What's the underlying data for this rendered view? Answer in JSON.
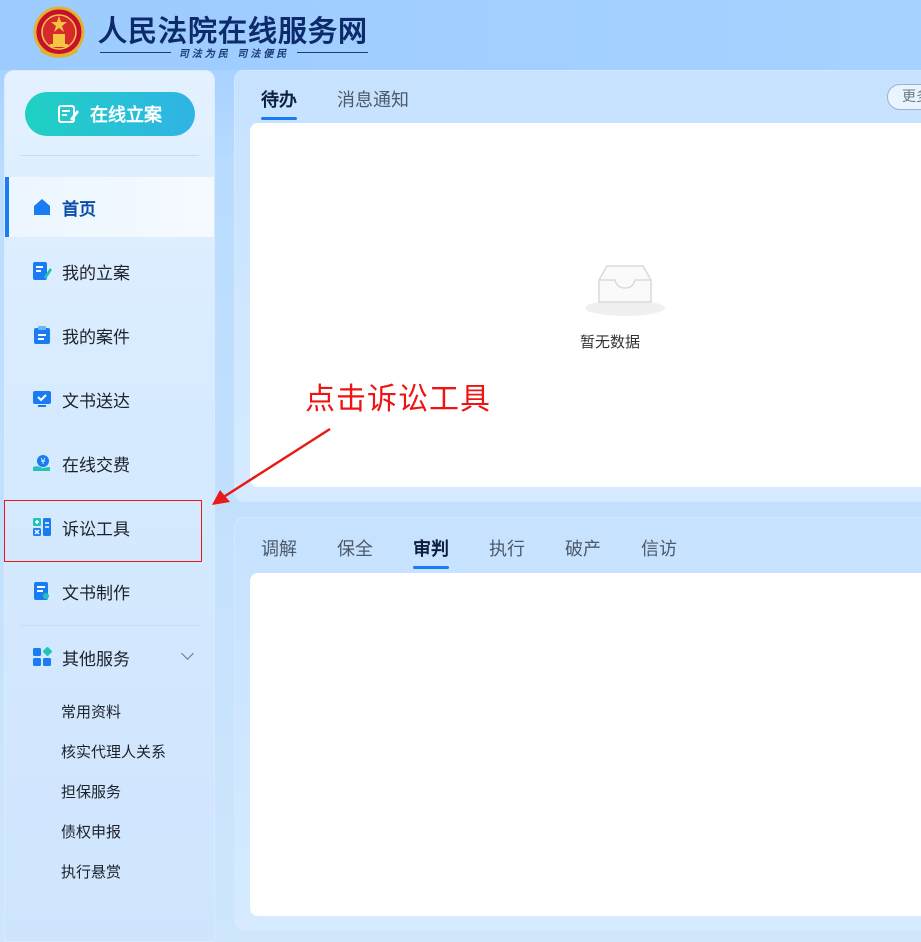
{
  "header": {
    "title": "人民法院在线服务网",
    "slogan": "司法为民  司法便民"
  },
  "sidebar": {
    "new_case_label": "在线立案",
    "items": [
      {
        "label": "首页",
        "icon": "home-icon",
        "active": true
      },
      {
        "label": "我的立案",
        "icon": "edit-doc-icon"
      },
      {
        "label": "我的案件",
        "icon": "clipboard-icon"
      },
      {
        "label": "文书送达",
        "icon": "monitor-check-icon"
      },
      {
        "label": "在线交费",
        "icon": "payment-icon"
      },
      {
        "label": "诉讼工具",
        "icon": "calculator-icon"
      },
      {
        "label": "文书制作",
        "icon": "doc-search-icon"
      },
      {
        "label": "其他服务",
        "icon": "apps-icon",
        "expanded": true
      }
    ],
    "sub_items": [
      "常用资料",
      "核实代理人关系",
      "担保服务",
      "债权申报",
      "执行悬赏"
    ]
  },
  "panel_todo": {
    "tabs": [
      {
        "label": "待办",
        "active": true
      },
      {
        "label": "消息通知"
      }
    ],
    "more_label": "更多",
    "empty_text": "暂无数据"
  },
  "panel_cases": {
    "tabs": [
      {
        "label": "调解"
      },
      {
        "label": "保全"
      },
      {
        "label": "审判",
        "active": true
      },
      {
        "label": "执行"
      },
      {
        "label": "破产"
      },
      {
        "label": "信访"
      }
    ]
  },
  "annotation": {
    "text": "点击诉讼工具",
    "color": "#ef1414"
  },
  "colors": {
    "accent": "#1a7cf2",
    "button_gradient_start": "#1fd1c2",
    "button_gradient_end": "#2fb3e6"
  }
}
